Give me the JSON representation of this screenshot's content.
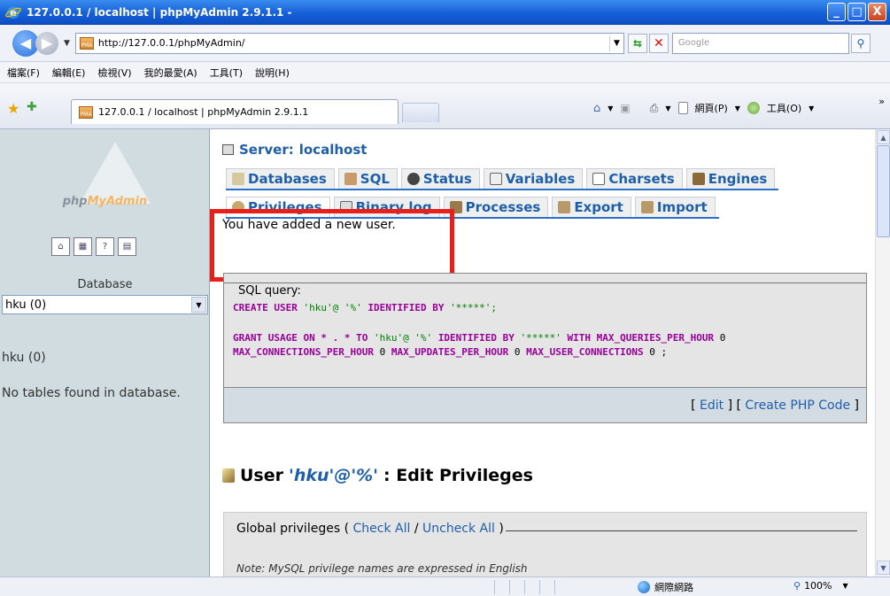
{
  "window": {
    "title": "127.0.0.1 / localhost | phpMyAdmin 2.9.1.1 -",
    "minimize": "_",
    "maximize": "□",
    "close": "X"
  },
  "address": {
    "url": "http://127.0.0.1/phpMyAdmin/",
    "search_placeholder": "Google"
  },
  "menu": [
    "檔案(F)",
    "編輯(E)",
    "檢視(V)",
    "我的最愛(A)",
    "工具(T)",
    "說明(H)"
  ],
  "tab": {
    "title": "127.0.0.1 / localhost | phpMyAdmin 2.9.1.1"
  },
  "command_bar": {
    "page": "網頁(P)",
    "tools": "工具(O)"
  },
  "sidebar": {
    "logo_php": "php",
    "logo_myadmin": "MyAdmin",
    "database_label": "Database",
    "database_selected": "hku (0)",
    "db_name": "hku (0)",
    "no_tables": "No tables found in database."
  },
  "main": {
    "server_prefix": "Server:",
    "server_name": "localhost",
    "tabs_row1": [
      "Databases",
      "SQL",
      "Status",
      "Variables",
      "Charsets",
      "Engines"
    ],
    "tabs_row2": [
      "Privileges",
      "Binary log",
      "Processes",
      "Export",
      "Import"
    ],
    "message": "You have added a new user."
  },
  "sql": {
    "legend": "SQL query:",
    "line1_kw": "CREATE USER",
    "line1_str": "'hku'@ '%'",
    "line1_kw2": "IDENTIFIED BY",
    "line1_str2": "'*****';",
    "line2_kw": "GRANT USAGE ON * . * TO",
    "line2_str": "'hku'@ '%'",
    "line2_kw2": "IDENTIFIED BY",
    "line2_str2": "'*****'",
    "line2_kw3": "WITH MAX_QUERIES_PER_HOUR",
    "line2_num": "0",
    "line3_kw": "MAX_CONNECTIONS_PER_HOUR",
    "line3_num1": "0",
    "line3_kw2": "MAX_UPDATES_PER_HOUR",
    "line3_num2": "0",
    "line3_kw3": "MAX_USER_CONNECTIONS",
    "line3_num3": "0",
    "line3_end": " ;",
    "edit": "Edit",
    "create_php": "Create PHP Code"
  },
  "user_section": {
    "prefix": "User",
    "account": "'hku'@'%'",
    "suffix": ": Edit Privileges"
  },
  "global": {
    "legend": "Global privileges",
    "check_all": "Check All",
    "uncheck_all": "Uncheck All",
    "note": "Note: MySQL privilege names are expressed in English"
  },
  "status": {
    "zone": "網際網路",
    "zoom": "100%"
  }
}
